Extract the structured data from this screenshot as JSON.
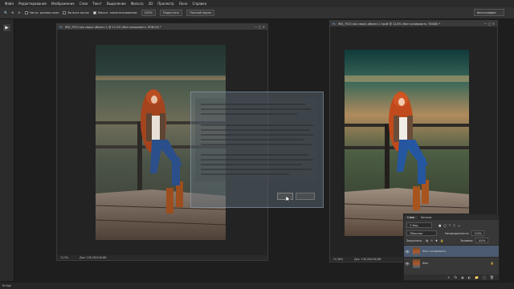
{
  "menu": [
    "Файл",
    "Редактирование",
    "Изображение",
    "Слои",
    "Текст",
    "Выделение",
    "Фильтр",
    "3D",
    "Просмотр",
    "Окно",
    "Справка"
  ],
  "options": {
    "scroll_all": "Частр. размер окон",
    "zoom_all": "Во всех окнах",
    "scrubby": "Масшт. перетаскиванием",
    "zoom_pct": "100%",
    "fit_screen": "Подогнать",
    "fill_screen": "Полный экран"
  },
  "workspace": "Фотография",
  "doc1": {
    "tab": "IMG_7923 как смарт-объект-1 @ 12,5% (Фон копировать, RGB/16) *",
    "zoom": "12,5%",
    "size": "Док: 138,2M/148,6M"
  },
  "doc2": {
    "tab": "IMG_7923 как смарт-объект-1 проб @ 12,8% (Фон копировать, RGB/8) *",
    "zoom": "12,38%",
    "size": "Док: 138,2M/148,6M"
  },
  "layers_panel": {
    "tabs": [
      "Слои",
      "Каналы"
    ],
    "blend": "Обычные",
    "opacity_label": "Непрозрачность:",
    "opacity": "100%",
    "lock_label": "Закрепить:",
    "fill_label": "Заливка:",
    "fill": "100%",
    "layers": [
      {
        "name": "Фон копировать",
        "selected": true
      },
      {
        "name": "Фон",
        "selected": false
      }
    ]
  },
  "status_left": "Bridge",
  "icons": [
    "zoom-icon",
    "zoom-in-icon",
    "zoom-out-icon",
    "play-icon",
    "eye-icon",
    "lock-icon",
    "link-icon",
    "fx-icon",
    "mask-icon",
    "folder-icon",
    "new-layer-icon",
    "trash-icon"
  ]
}
